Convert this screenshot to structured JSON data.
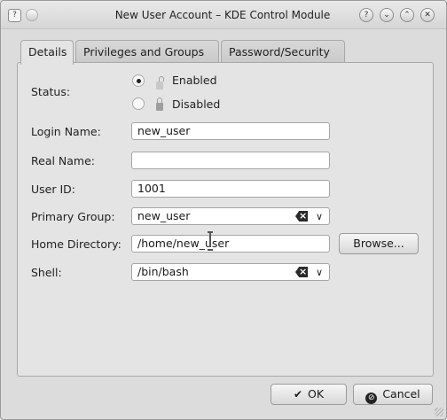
{
  "window": {
    "title": "New User Account – KDE Control Module",
    "app_icon": "help-page-icon",
    "menu_glyph": "?",
    "title_buttons": [
      {
        "name": "help-icon",
        "glyph": "?"
      },
      {
        "name": "minimize-icon",
        "glyph": "⌄"
      },
      {
        "name": "maximize-icon",
        "glyph": "⌃"
      },
      {
        "name": "close-icon",
        "glyph": "✕"
      }
    ]
  },
  "tabs": [
    {
      "label": "Details",
      "active": true
    },
    {
      "label": "Privileges and Groups",
      "active": false
    },
    {
      "label": "Password/Security",
      "active": false
    }
  ],
  "form": {
    "status_label": "Status:",
    "status_options": [
      {
        "label": "Enabled",
        "checked": true
      },
      {
        "label": "Disabled",
        "checked": false
      }
    ],
    "login_name_label": "Login Name:",
    "login_name_value": "new_user",
    "real_name_label": "Real Name:",
    "real_name_value": "",
    "user_id_label": "User ID:",
    "user_id_value": "1001",
    "primary_group_label": "Primary Group:",
    "primary_group_value": "new_user",
    "home_dir_label": "Home Directory:",
    "home_dir_value": "/home/new_user",
    "browse_label": "Browse...",
    "shell_label": "Shell:",
    "shell_value": "/bin/bash"
  },
  "footer": {
    "ok_label": "OK",
    "cancel_label": "Cancel"
  }
}
